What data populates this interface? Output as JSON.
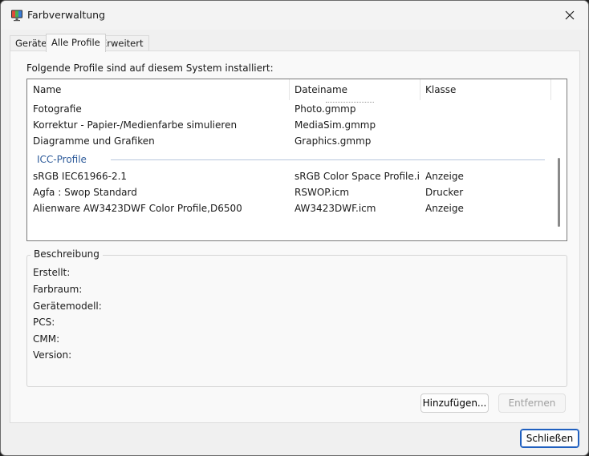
{
  "window": {
    "title": "Farbverwaltung"
  },
  "tabs": [
    {
      "label": "Geräte"
    },
    {
      "label": "Alle Profile"
    },
    {
      "label": "Erweitert"
    }
  ],
  "intro_text": "Folgende Profile sind auf diesem System installiert:",
  "listview": {
    "columns": [
      "Name",
      "Dateiname",
      "Klasse"
    ],
    "wcs_rows": [
      {
        "name": "Fotografie",
        "file": "Photo.gmmp",
        "class": ""
      },
      {
        "name": "Korrektur - Papier-/Medienfarbe simulieren",
        "file": "MediaSim.gmmp",
        "class": ""
      },
      {
        "name": "Diagramme und Grafiken",
        "file": "Graphics.gmmp",
        "class": ""
      }
    ],
    "icc_group_label": "ICC-Profile",
    "icc_rows": [
      {
        "name": "sRGB IEC61966-2.1",
        "file": "sRGB Color Space Profile.ic...",
        "class": "Anzeige"
      },
      {
        "name": "Agfa : Swop Standard",
        "file": "RSWOP.icm",
        "class": "Drucker"
      },
      {
        "name": "Alienware AW3423DWF Color Profile,D6500",
        "file": "AW3423DWF.icm",
        "class": "Anzeige"
      }
    ]
  },
  "description": {
    "title": "Beschreibung",
    "labels": [
      "Erstellt:",
      "Farbraum:",
      "Gerätemodell:",
      "PCS:",
      "CMM:",
      "Version:"
    ]
  },
  "buttons": {
    "add": "Hinzufügen...",
    "remove": "Entfernen",
    "close": "Schließen"
  }
}
